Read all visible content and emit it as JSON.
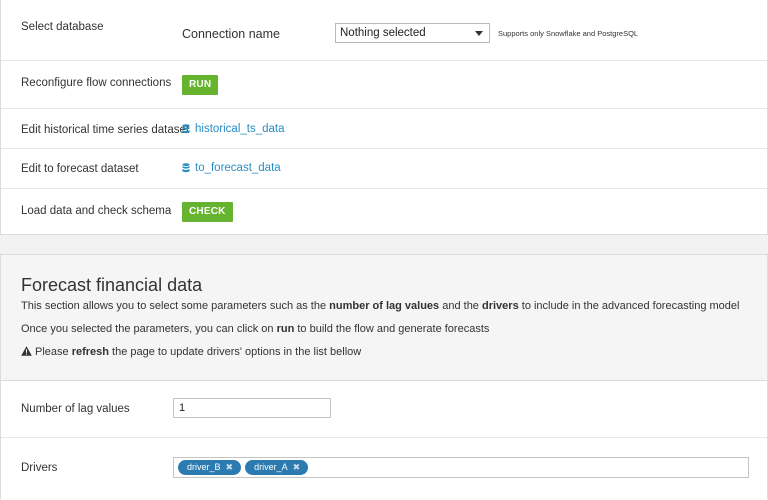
{
  "setup": {
    "select_database": {
      "label": "Select database",
      "connection_label": "Connection name",
      "selected": "Nothing selected",
      "hint": "Supports only Snowflake and PostgreSQL"
    },
    "reconfigure": {
      "label": "Reconfigure flow connections",
      "button": "RUN"
    },
    "edit_historical": {
      "label": "Edit historical time series dataset",
      "link": "historical_ts_data",
      "icon": "database-icon"
    },
    "edit_forecast": {
      "label": "Edit to forecast dataset",
      "link": "to_forecast_data",
      "icon": "database-icon"
    },
    "load_data": {
      "label": "Load data and check schema",
      "button": "CHECK"
    }
  },
  "forecast": {
    "title": "Forecast financial data",
    "line1": {
      "p1": "This section allows you to select some parameters such as the ",
      "b1": "number of lag values",
      "p2": " and the ",
      "b2": "drivers",
      "p3": " to include in the advanced forecasting model"
    },
    "line2": {
      "p1": "Once you selected the parameters, you can click on ",
      "b1": "run",
      "p2": " to build the flow and generate forecasts"
    },
    "line3": {
      "p1": "Please ",
      "b1": "refresh",
      "p2": " the page to update drivers' options in the list bellow",
      "icon": "warning-icon"
    },
    "lag": {
      "label": "Number of lag values",
      "value": "1"
    },
    "drivers": {
      "label": "Drivers",
      "tags": [
        {
          "text": "driver_B",
          "remove": "✖"
        },
        {
          "text": "driver_A",
          "remove": "✖"
        }
      ]
    }
  },
  "colors": {
    "accent_green": "#65b32e",
    "link_blue": "#2a8ec5",
    "tag_blue": "#2b7bb0"
  }
}
